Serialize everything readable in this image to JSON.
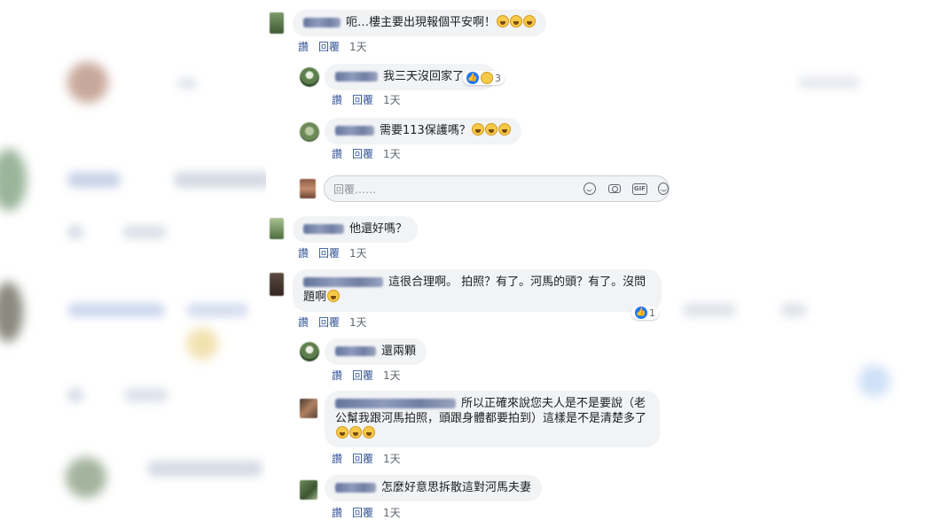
{
  "colors": {
    "link": "#385898",
    "bubble": "#f2f3f5",
    "like_blue": "#2078f4",
    "muted": "#606770"
  },
  "actions": {
    "like_label": "讚",
    "reply_label": "回覆",
    "time_label": "1天"
  },
  "comments": [
    {
      "text": "呃…樓主要出現報個平安啊！",
      "emojis": 3
    },
    {
      "text": "我三天沒回家了",
      "reaction_count": "3"
    },
    {
      "text": "需要113保護嗎？",
      "emojis": 3
    },
    {
      "text": "他還好嗎？"
    },
    {
      "text": "這很合理啊。 拍照？有了。河馬的頭？有了。沒問題啊",
      "reaction_count": "1"
    },
    {
      "text": "還兩顆"
    },
    {
      "text": "所以正確來說您夫人是不是要說（老公幫我跟河馬拍照，頭跟身體都要拍到）這樣是不是清楚多了",
      "emojis": 3
    },
    {
      "text": "怎麼好意思拆散這對河馬夫妻"
    }
  ],
  "reply_box": {
    "placeholder": "回覆……",
    "icons": [
      "emoji-icon",
      "camera-icon",
      "gif-icon",
      "sticker-icon"
    ]
  }
}
